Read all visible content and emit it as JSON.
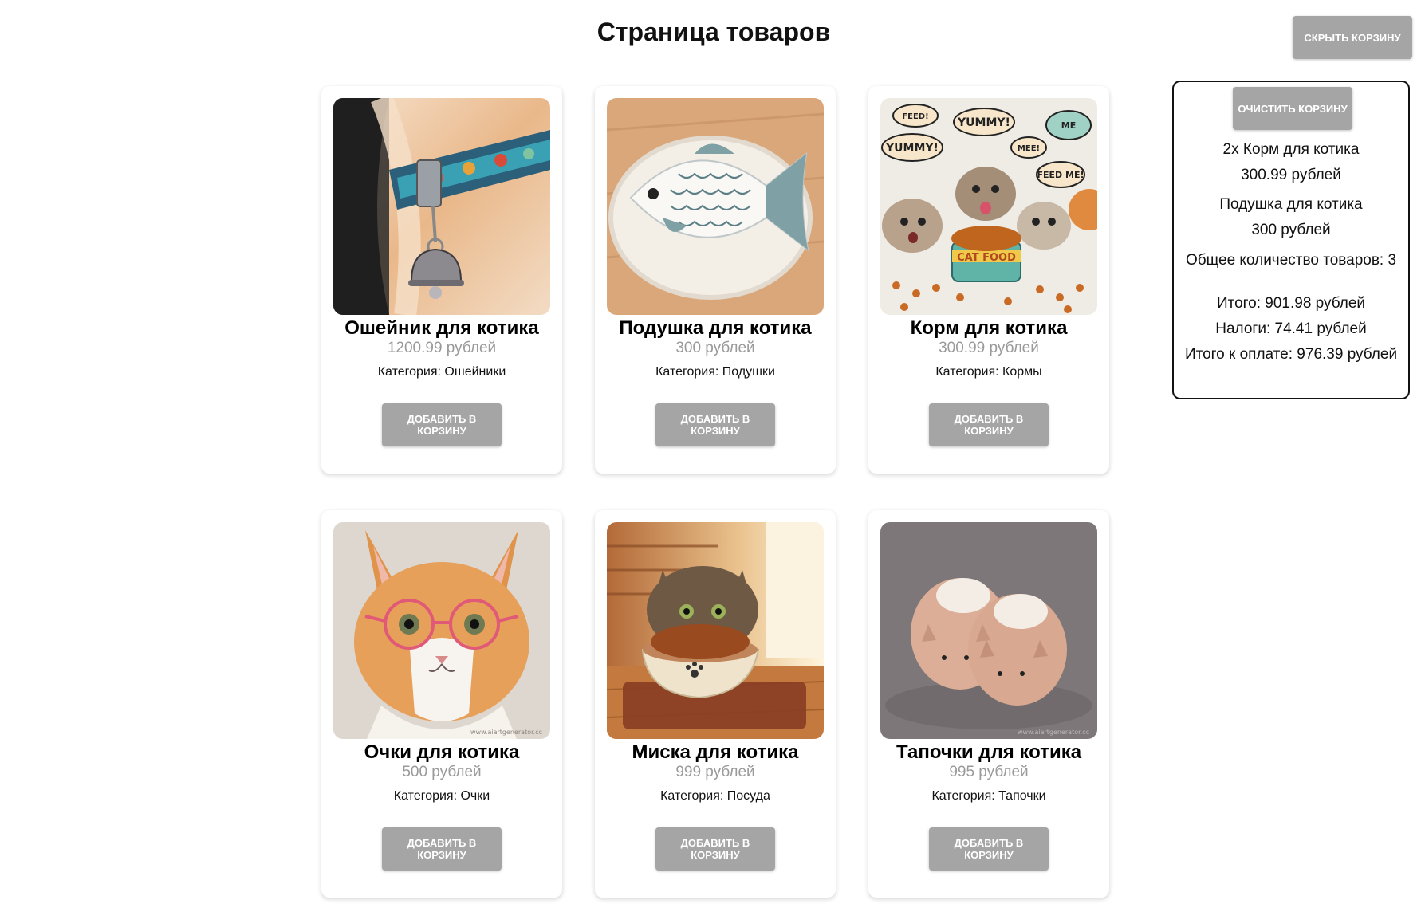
{
  "header": {
    "title": "Страница товаров",
    "toggle_cart_label": "Скрыть корзину"
  },
  "products": [
    {
      "name": "Ошейник для котика",
      "price": "1200.99 рублей",
      "category": "Категория: Ошейники",
      "button": "Добавить в корзину",
      "image_icon": "cat-collar-image"
    },
    {
      "name": "Подушка для котика",
      "price": "300 рублей",
      "category": "Категория: Подушки",
      "button": "Добавить в корзину",
      "image_icon": "fish-pillow-image"
    },
    {
      "name": "Корм для котика",
      "price": "300.99 рублей",
      "category": "Категория: Кормы",
      "button": "Добавить в корзину",
      "image_icon": "cat-food-image",
      "image_text": "CAT FOOD",
      "image_bubbles": [
        "FEED!",
        "YUMMY!",
        "ME",
        "YUMMY!",
        "MEE!",
        "FEED ME!"
      ]
    },
    {
      "name": "Очки для котика",
      "price": "500 рублей",
      "category": "Категория: Очки",
      "button": "Добавить в корзину",
      "image_icon": "cat-glasses-image",
      "watermark": "www.aiartgenerator.cc"
    },
    {
      "name": "Миска для котика",
      "price": "999 рублей",
      "category": "Категория: Посуда",
      "button": "Добавить в корзину",
      "image_icon": "cat-bowl-image"
    },
    {
      "name": "Тапочки для котика",
      "price": "995 рублей",
      "category": "Категория: Тапочки",
      "button": "Добавить в корзину",
      "image_icon": "cat-slippers-image",
      "watermark": "www.aiartgenerator.cc"
    }
  ],
  "cart": {
    "clear_label": "Очистить корзину",
    "items": [
      {
        "label": "2x  Корм для котика",
        "price": "300.99 рублей"
      },
      {
        "label": "Подушка для котика",
        "price": "300 рублей"
      }
    ],
    "total_count": "Общее количество товаров: 3",
    "subtotal": "Итого: 901.98 рублей",
    "taxes": "Налоги: 74.41 рублей",
    "grand_total": "Итого к оплате: 976.39 рублей"
  },
  "colors": {
    "button_bg": "#a5a5a5",
    "price_text": "#9a9a9a",
    "cart_border": "#111111"
  }
}
